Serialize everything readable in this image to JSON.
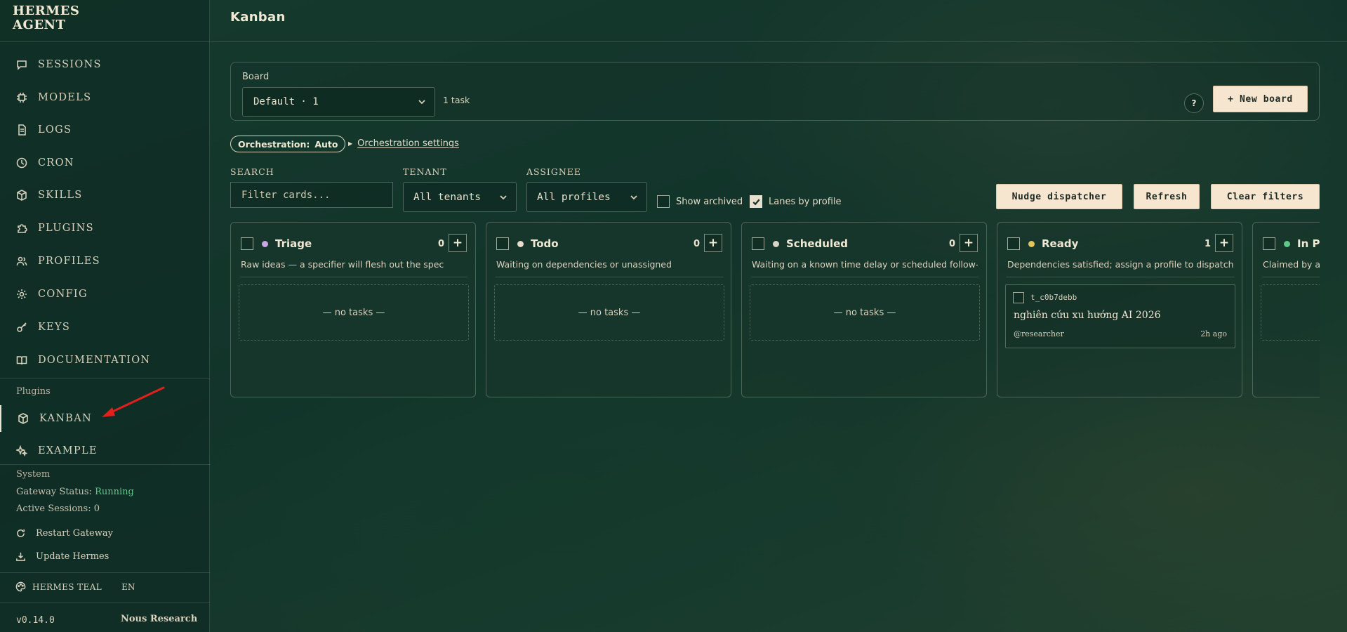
{
  "app": {
    "logo_line1": "HERMES",
    "logo_line2": "AGENT",
    "page_title": "Kanban"
  },
  "sidebar": {
    "items": [
      {
        "label": "SESSIONS",
        "icon": "chat-icon"
      },
      {
        "label": "MODELS",
        "icon": "chip-icon"
      },
      {
        "label": "LOGS",
        "icon": "document-icon"
      },
      {
        "label": "CRON",
        "icon": "clock-icon"
      },
      {
        "label": "SKILLS",
        "icon": "package-icon"
      },
      {
        "label": "PLUGINS",
        "icon": "puzzle-icon"
      },
      {
        "label": "PROFILES",
        "icon": "users-icon"
      },
      {
        "label": "CONFIG",
        "icon": "gear-icon"
      },
      {
        "label": "KEYS",
        "icon": "key-icon"
      },
      {
        "label": "DOCUMENTATION",
        "icon": "book-icon"
      }
    ],
    "plugins_title": "Plugins",
    "plugin_items": [
      {
        "label": "KANBAN",
        "icon": "package-icon",
        "active": true
      },
      {
        "label": "EXAMPLE",
        "icon": "sparkles-icon",
        "active": false
      }
    ],
    "system_title": "System",
    "gateway_status_label": "Gateway Status:",
    "gateway_status_value": "Running",
    "active_sessions": "Active Sessions: 0",
    "restart_gateway": "Restart Gateway",
    "update_hermes": "Update Hermes",
    "theme": "HERMES TEAL",
    "language": "EN",
    "version": "v0.14.0",
    "vendor": "Nous Research"
  },
  "board": {
    "label": "Board",
    "selected": "Default · 1",
    "task_count": "1 task",
    "help": "?",
    "new_board": "+ New board"
  },
  "orchestration": {
    "label": "Orchestration:",
    "value": "Auto",
    "settings_link": "Orchestration settings"
  },
  "filters": {
    "search_label": "SEARCH",
    "search_placeholder": "Filter cards...",
    "tenant_label": "TENANT",
    "tenant_value": "All tenants",
    "assignee_label": "ASSIGNEE",
    "assignee_value": "All profiles",
    "show_archived": "Show archived",
    "lanes_by_profile": "Lanes by profile"
  },
  "actions": {
    "nudge": "Nudge dispatcher",
    "refresh": "Refresh",
    "clear": "Clear filters"
  },
  "colors": {
    "triage": "#c9a6e6",
    "todo": "#e6dccb",
    "scheduled": "#d9d4c6",
    "ready": "#e2c45a",
    "in_progress": "#5fc98b"
  },
  "columns": [
    {
      "name": "Triage",
      "count": "0",
      "desc": "Raw ideas — a specifier will flesh out the spec",
      "empty": "— no tasks —"
    },
    {
      "name": "Todo",
      "count": "0",
      "desc": "Waiting on dependencies or unassigned",
      "empty": "— no tasks —"
    },
    {
      "name": "Scheduled",
      "count": "0",
      "desc": "Waiting on a known time delay or scheduled follow-up",
      "empty": "— no tasks —"
    },
    {
      "name": "Ready",
      "count": "1",
      "desc": "Dependencies satisfied; assign a profile to dispatch",
      "card": {
        "id": "t_c0b7debb",
        "title": "nghiên cứu xu hướng AI 2026",
        "assignee": "@researcher",
        "age": "2h ago"
      }
    },
    {
      "name": "In Pr",
      "count": "",
      "desc": "Claimed by a w"
    }
  ],
  "add_symbol": "+"
}
